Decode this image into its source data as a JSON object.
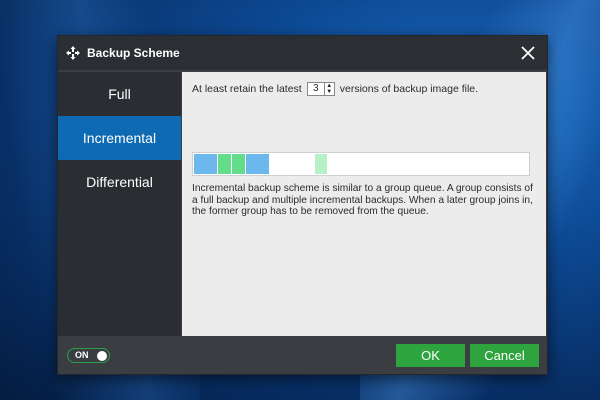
{
  "dialog": {
    "title": "Backup Scheme",
    "title_icon": "backup-scheme-icon",
    "close_icon": "close-icon"
  },
  "sidebar": {
    "items": [
      {
        "label": "Full",
        "active": false
      },
      {
        "label": "Incremental",
        "active": true
      },
      {
        "label": "Differential",
        "active": false
      }
    ]
  },
  "content": {
    "retain_prefix": "At least retain the latest",
    "retain_value": "3",
    "retain_suffix": "versions of backup image file.",
    "queue_colors": {
      "full": "#6cb8ec",
      "incremental": "#62de8a",
      "faded_incremental": "#b6f0c6"
    },
    "description": "Incremental backup scheme is similar to a group queue. A group consists of a full backup and multiple incremental backups. When a later group joins in, the former group has to be removed from the queue."
  },
  "footer": {
    "toggle_label": "ON",
    "ok_label": "OK",
    "cancel_label": "Cancel",
    "accent": "#2ea43f"
  }
}
